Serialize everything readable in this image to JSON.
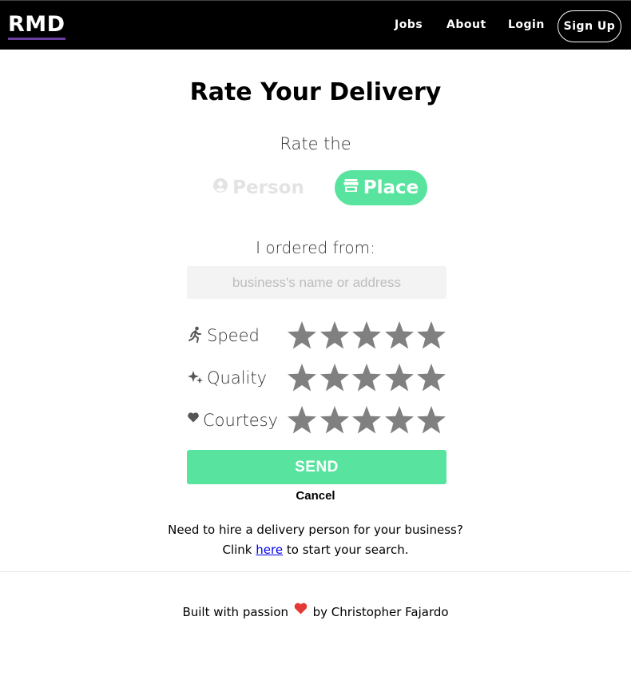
{
  "nav": {
    "logo": "RMD",
    "links": [
      "Jobs",
      "About",
      "Login"
    ],
    "signup": "Sign Up"
  },
  "page": {
    "title": "Rate Your Delivery",
    "rate_the": "Rate the"
  },
  "toggle": {
    "person": "Person",
    "place": "Place",
    "selected": "Place",
    "person_icon": "user-circle-icon",
    "place_icon": "store-icon"
  },
  "form": {
    "ordered_label": "I ordered from:",
    "search_placeholder": "business's name or address",
    "search_value": "",
    "ratings": [
      {
        "label": "Speed",
        "icon": "running-person-icon",
        "stars": 0,
        "max": 5
      },
      {
        "label": "Quality",
        "icon": "sparkles-icon",
        "stars": 0,
        "max": 5
      },
      {
        "label": "Courtesy",
        "icon": "heart-icon",
        "stars": 0,
        "max": 5
      }
    ],
    "send": "SEND",
    "cancel": "Cancel"
  },
  "hire": {
    "line1": "Need to hire a delivery person for your business?",
    "prefix": "Clink",
    "link": "here",
    "suffix": "to start your search."
  },
  "footer": {
    "prefix": "Built with passion",
    "suffix": "by Christopher Fajardo"
  },
  "colors": {
    "accent": "#58e49e",
    "navbar": "#000000",
    "logo_underline": "#6b3fa0",
    "star": "#808080",
    "heart": "#e53935",
    "inactive_toggle": "#e3e3e3"
  }
}
